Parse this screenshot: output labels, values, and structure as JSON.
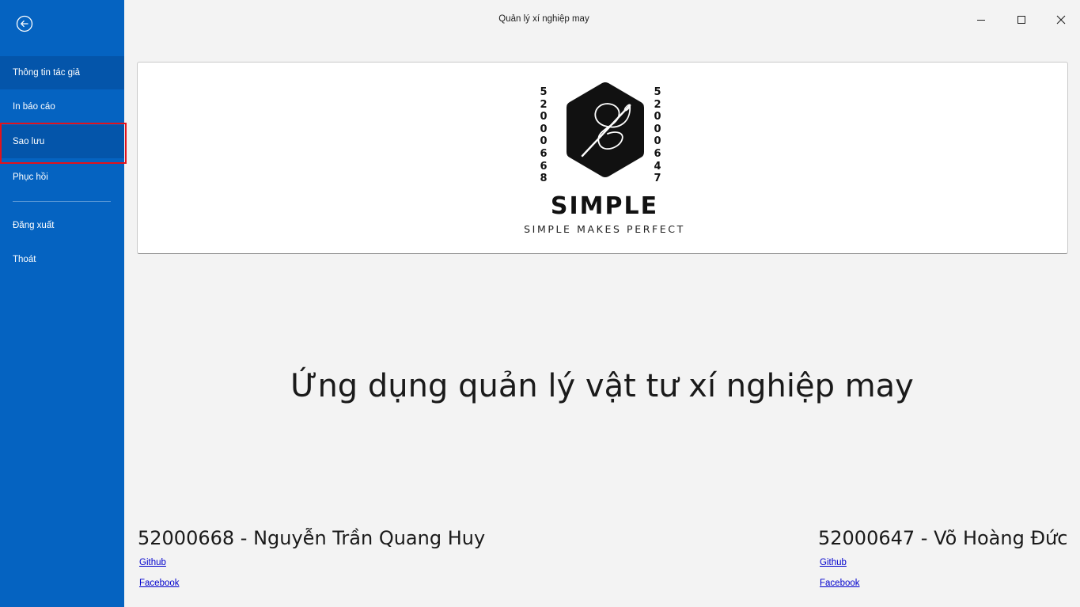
{
  "window": {
    "title": "Quản lý xí nghiệp may"
  },
  "sidebar": {
    "back_icon": "arrow-left-circle-icon",
    "items": [
      {
        "label": "Thông tin tác giả"
      },
      {
        "label": "In báo cáo"
      },
      {
        "label": "Sao lưu"
      },
      {
        "label": "Phục hồi"
      },
      {
        "label": "Đăng xuất"
      },
      {
        "label": "Thoát"
      }
    ],
    "accent_color": "#0563c1",
    "highlight_border_color": "#e3121b"
  },
  "banner": {
    "left_id": "52000668",
    "right_id": "52000647",
    "brand": "SIMPLE",
    "tagline": "SIMPLE MAKES PERFECT",
    "logo_icon": "needle-thread-hexagon-icon"
  },
  "main": {
    "heading": "Ứng dụng quản lý vật tư xí nghiệp may"
  },
  "authors": [
    {
      "name": "52000668 - Nguyễn Trần Quang Huy",
      "github": "Github",
      "facebook": "Facebook"
    },
    {
      "name": "52000647 - Võ Hoàng Đức",
      "github": "Github",
      "facebook": "Facebook"
    }
  ]
}
